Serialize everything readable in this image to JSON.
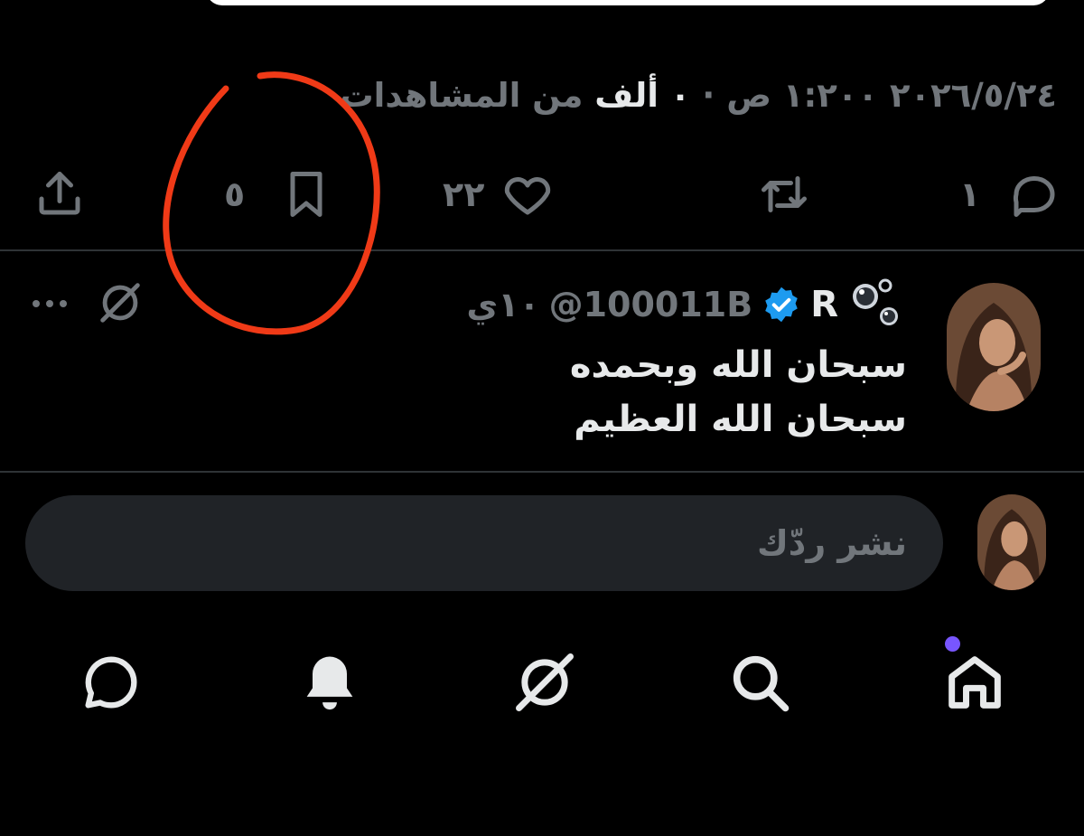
{
  "tweet": {
    "date": "٢٠٢٦/٥/٢٤",
    "time": "١:٢٠٠ ص",
    "views_count": "٠ ألف",
    "views_label": "من المشاهدات",
    "actions": {
      "replies": "١",
      "likes": "٢٢",
      "bookmarks": "٥"
    }
  },
  "reply": {
    "name": "R",
    "handle": "@100011B",
    "time": "١٠ي",
    "text_line1": "سبحان الله وبحمده",
    "text_line2": "سبحان الله العظيم",
    "verified_color": "#1d9bf0"
  },
  "composer": {
    "placeholder": "نشر ردّك"
  },
  "nav": {
    "items": [
      "message-icon",
      "bell-icon",
      "grok-icon",
      "search-icon",
      "home-icon"
    ],
    "notification_dot_color": "#7856ff"
  },
  "annotation_color": "#f03a17"
}
